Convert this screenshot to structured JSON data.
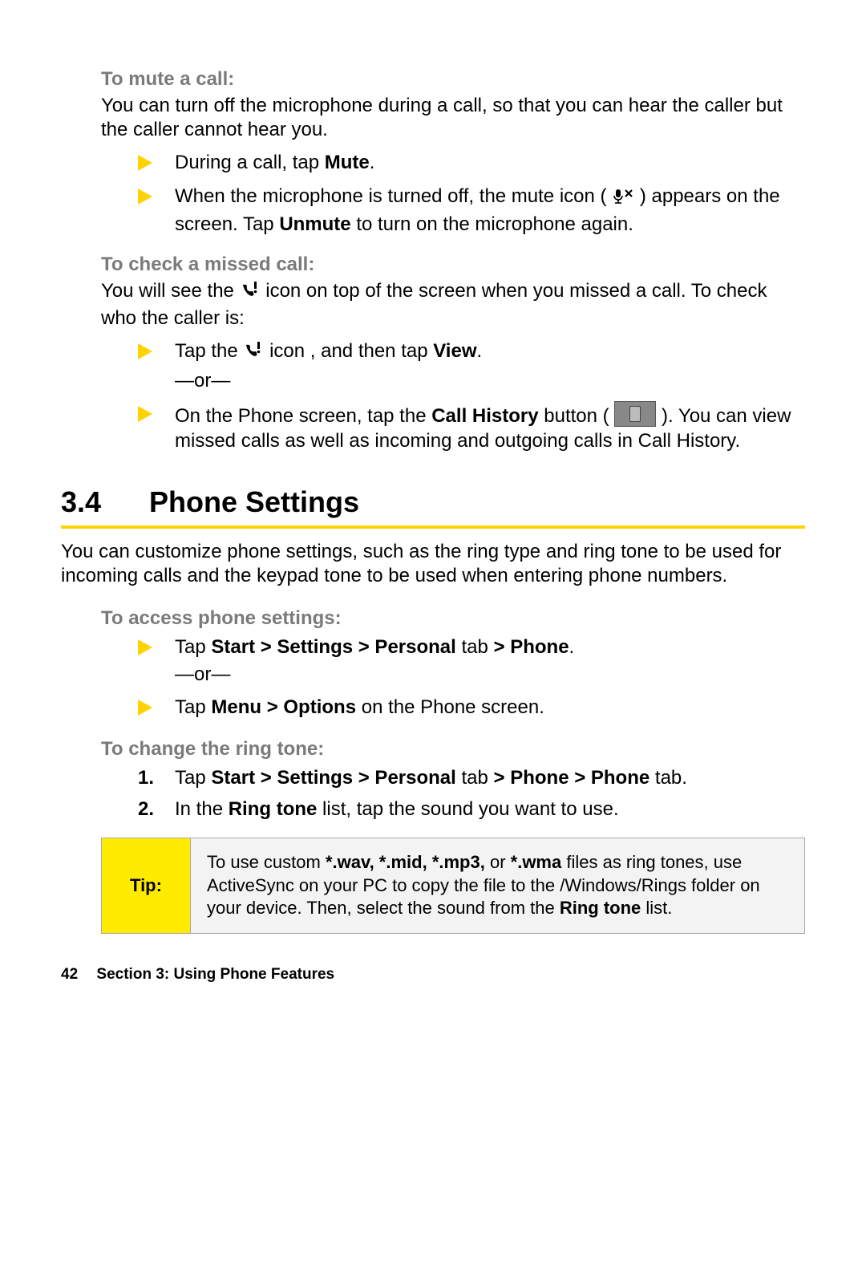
{
  "mute": {
    "heading": "To mute a call:",
    "para": "You can turn off the microphone during a call, so that you can hear the caller but the caller cannot hear you.",
    "step1_pre": "During a call, tap ",
    "step1_bold": "Mute",
    "step1_post": ".",
    "step2_pre": "When the microphone is turned off, the mute icon ( ",
    "step2_mid": " ) appears on the screen. Tap ",
    "step2_bold": "Unmute",
    "step2_post": " to turn on the microphone again."
  },
  "missed": {
    "heading": "To check a missed call:",
    "para_pre": "You will see the ",
    "para_post": " icon on top of the screen when you missed a call. To check who the caller is:",
    "step1_pre": "Tap the ",
    "step1_mid": " icon , and then tap ",
    "step1_bold": "View",
    "step1_post": ".",
    "or": "—or—",
    "step2_pre": "On the Phone screen, tap the ",
    "step2_bold": "Call History",
    "step2_mid": " button ( ",
    "step2_post": " ). You can view missed calls as well as incoming and outgoing calls in Call History."
  },
  "section": {
    "num": "3.4",
    "title": "Phone Settings",
    "intro": "You can customize phone settings, such as the ring type and ring tone to be used for incoming calls and the keypad tone to be used when entering phone numbers."
  },
  "access": {
    "heading": "To access phone settings:",
    "step1_pre": "Tap ",
    "step1_b1": "Start > Settings > Personal",
    "step1_mid": " tab ",
    "step1_b2": "> Phone",
    "step1_post": ".",
    "or": "—or—",
    "step2_pre": "Tap ",
    "step2_bold": "Menu > Options",
    "step2_post": " on the Phone screen."
  },
  "ringtone": {
    "heading": "To change the ring tone:",
    "n1_marker": "1.",
    "n1_pre": "Tap ",
    "n1_b1": "Start > Settings > Personal",
    "n1_mid": " tab ",
    "n1_b2": "> Phone > Phone",
    "n1_post": " tab.",
    "n2_marker": "2.",
    "n2_pre": "In the ",
    "n2_bold": "Ring tone",
    "n2_post": " list, tap the sound you want to use."
  },
  "tip": {
    "label": "Tip:",
    "pre": "To use custom ",
    "b1": "*.wav, *.mid, *.mp3,",
    "mid1": " or ",
    "b2": "*.wma",
    "mid2": " files as ring tones, use ActiveSync on your PC to copy the file to the /Windows/Rings folder on your device. Then, select the sound from the ",
    "b3": "Ring tone",
    "post": " list."
  },
  "footer": {
    "page": "42",
    "section": "Section 3: Using Phone Features"
  }
}
